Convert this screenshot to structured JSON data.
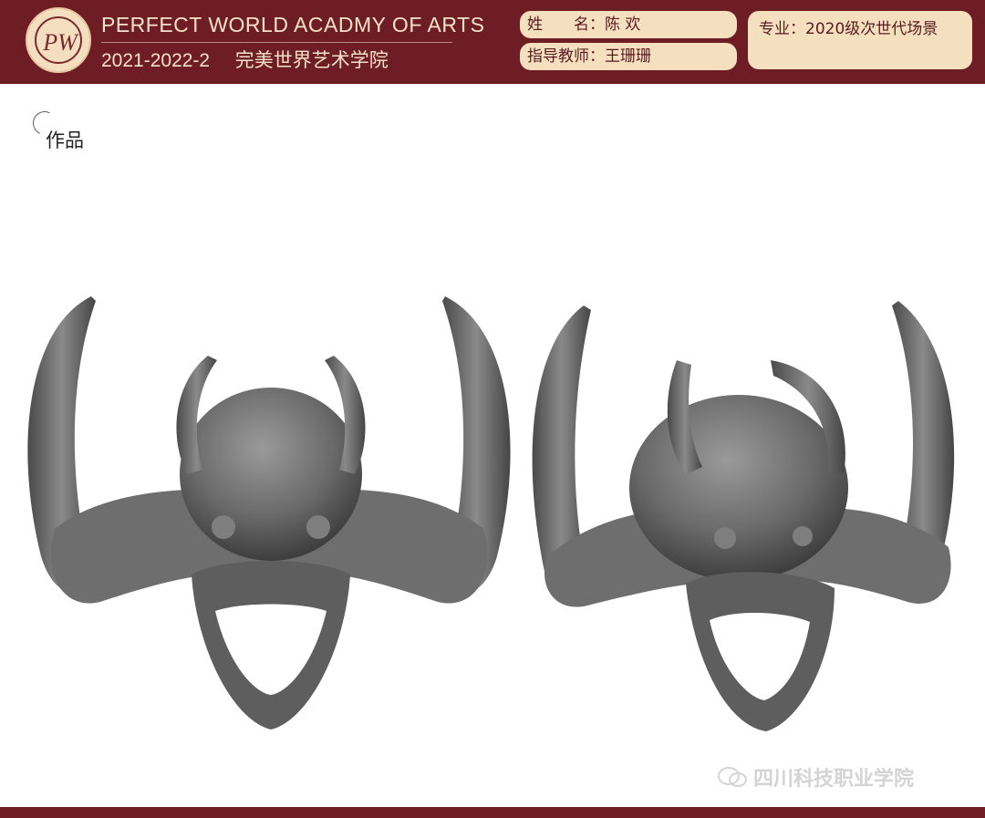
{
  "header": {
    "logo_letters": "PW",
    "title_en": "PERFECT WORLD ACADMY OF ARTS",
    "term": "2021-2022-2",
    "school_cn": "完美世界艺术学院",
    "name_label": "姓　　名：",
    "name_value": "陈 欢",
    "teacher_label": "指导教师：",
    "teacher_value": "王珊珊",
    "major_label": "专业：",
    "major_value": "2020级次世代场景"
  },
  "section": {
    "title": "作品"
  },
  "artwork": {
    "views": [
      {
        "view": "front",
        "subject": "horned-demon-skull-sculpt"
      },
      {
        "view": "three-quarter",
        "subject": "horned-demon-skull-sculpt"
      }
    ]
  },
  "watermark": {
    "text": "四川科技职业学院",
    "icon": "wechat-icon"
  },
  "colors": {
    "header_bg": "#6e1d24",
    "pill_bg": "#f4dfbf",
    "text_light": "#f4e2c8",
    "sculpt": "#6b6b6b"
  }
}
